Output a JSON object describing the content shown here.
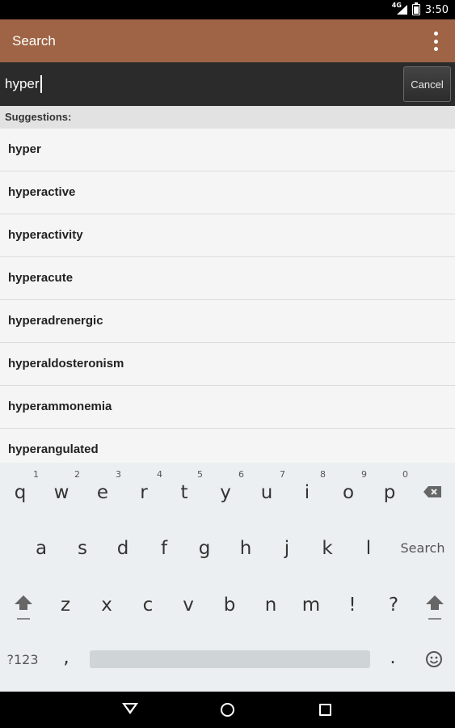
{
  "status_bar": {
    "network": "4G",
    "time": "3:50"
  },
  "app_bar": {
    "title": "Search"
  },
  "search": {
    "query": "hyper",
    "cancel_label": "Cancel"
  },
  "suggestions": {
    "header": "Suggestions:",
    "items": [
      "hyper",
      "hyperactive",
      "hyperactivity",
      "hyperacute",
      "hyperadrenergic",
      "hyperaldosteronism",
      "hyperammonemia",
      "hyperangulated"
    ]
  },
  "keyboard": {
    "row1": [
      {
        "key": "q",
        "hint": "1"
      },
      {
        "key": "w",
        "hint": "2"
      },
      {
        "key": "e",
        "hint": "3"
      },
      {
        "key": "r",
        "hint": "4"
      },
      {
        "key": "t",
        "hint": "5"
      },
      {
        "key": "y",
        "hint": "6"
      },
      {
        "key": "u",
        "hint": "7"
      },
      {
        "key": "i",
        "hint": "8"
      },
      {
        "key": "o",
        "hint": "9"
      },
      {
        "key": "p",
        "hint": "0"
      }
    ],
    "row2": [
      "a",
      "s",
      "d",
      "f",
      "g",
      "h",
      "j",
      "k",
      "l"
    ],
    "row3": [
      "z",
      "x",
      "c",
      "v",
      "b",
      "n",
      "m",
      "!",
      "?"
    ],
    "search_label": "Search",
    "symbols_label": "?123",
    "comma": ",",
    "period": "."
  },
  "colors": {
    "app_bar": "#9e6445",
    "search_bar": "#2b2b2b",
    "keyboard": "#eceff1"
  }
}
